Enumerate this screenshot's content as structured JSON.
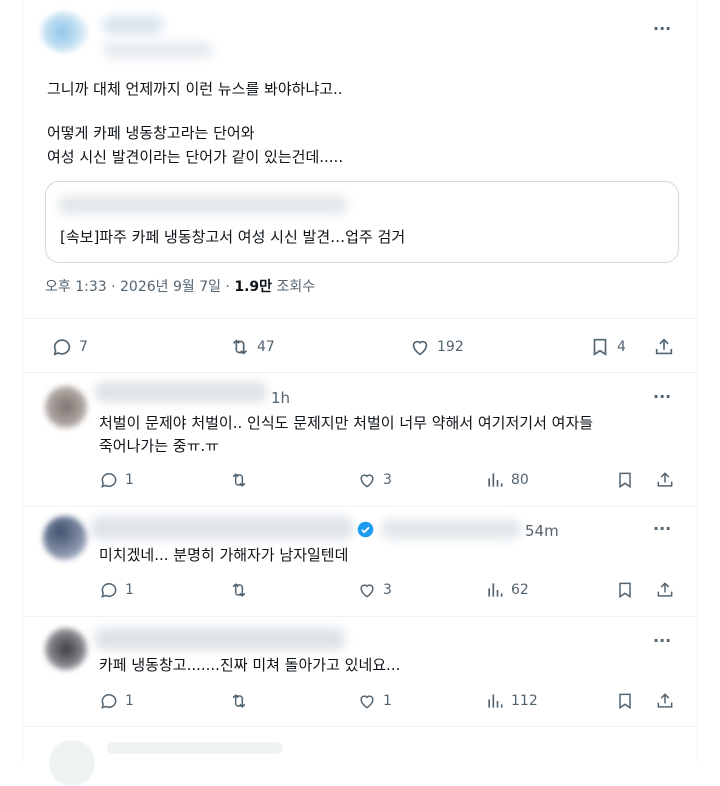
{
  "main_post": {
    "line1": "그니까 대체 언제까지 이런 뉴스를 봐야하냐고..",
    "line2": "어떻게 카페 냉동창고라는 단어와",
    "line3": "여성 시신 발견이라는 단어가 같이 있는건데.....",
    "quote_headline": "[속보]파주 카페 냉동창고서 여성 시신 발견…업주 검거",
    "timestamp": "오후 1:33 · 2026년 9월 7일 ·",
    "views_count": "1.9만",
    "views_label": "조회수",
    "replies": "7",
    "reposts": "47",
    "likes": "192",
    "bookmarks": "4"
  },
  "replies": [
    {
      "time": "1h",
      "text_line1": "처벌이 문제야 처벌이.. 인식도 문제지만 처벌이 너무 약해서 여기저기서 여자들",
      "text_line2": "죽어나가는 중ㅠ.ㅠ",
      "replies": "1",
      "reposts": "",
      "likes": "3",
      "views": "80"
    },
    {
      "time": "54m",
      "verified": true,
      "text_line1": "미치겠네... 분명히 가해자가 남자일텐데",
      "replies": "1",
      "reposts": "",
      "likes": "3",
      "views": "62"
    },
    {
      "text_line1": "카페 냉동창고.......진짜 미쳐 돌아가고 있네요...",
      "replies": "1",
      "reposts": "",
      "likes": "1",
      "views": "112"
    }
  ],
  "more_label": "···",
  "colors": {
    "text": "#0f1419",
    "muted": "#536471",
    "border": "#eff3f4",
    "verified": "#1d9bf0"
  },
  "icons": [
    "more-icon",
    "reply-icon",
    "repost-icon",
    "like-icon",
    "bookmark-icon",
    "share-icon",
    "views-icon",
    "verified-badge-icon"
  ]
}
